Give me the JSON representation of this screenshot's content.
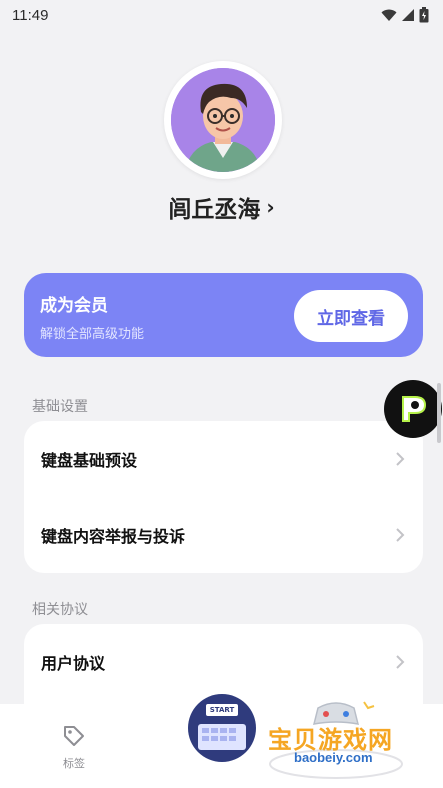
{
  "status_bar": {
    "time": "11:49"
  },
  "profile": {
    "name": "闾丘丞海",
    "chevron": "›"
  },
  "vip": {
    "title": "成为会员",
    "subtitle": "解锁全部高级功能",
    "button": "立即查看"
  },
  "sections": {
    "basic": {
      "label": "基础设置",
      "items": [
        {
          "label": "键盘基础预设"
        },
        {
          "label": "键盘内容举报与投诉"
        }
      ]
    },
    "agreements": {
      "label": "相关协议",
      "items": [
        {
          "label": "用户协议"
        }
      ]
    }
  },
  "bottom_nav": {
    "tag_label": "标签",
    "start_label": "START"
  },
  "watermark": {
    "title": "宝贝游戏网",
    "url": "baobeiy.com"
  },
  "colors": {
    "accent": "#7c84f5",
    "page_bg": "#f2f2f4",
    "avatar_bg": "#a884e8"
  }
}
